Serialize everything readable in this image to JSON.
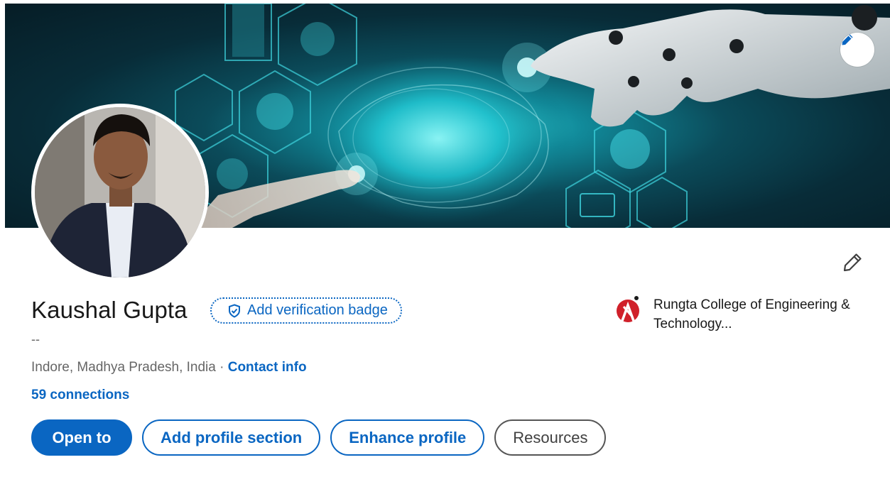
{
  "profile": {
    "name": "Kaushal Gupta",
    "verification_label": "Add verification badge",
    "headline": "--",
    "location": "Indore, Madhya Pradesh, India",
    "separator": " · ",
    "contact_label": "Contact info",
    "connections": "59 connections"
  },
  "education": {
    "name": "Rungta College of Engineering & Technology..."
  },
  "actions": {
    "open_to": "Open to",
    "add_section": "Add profile section",
    "enhance": "Enhance profile",
    "resources": "Resources"
  },
  "icons": {
    "banner_edit": "pencil-icon",
    "intro_edit": "pencil-icon",
    "verify": "shield-check-icon",
    "school_logo": "rungta-logo-icon"
  },
  "colors": {
    "accent": "#0a66c2",
    "text_primary": "#191919",
    "text_secondary": "#666666"
  }
}
